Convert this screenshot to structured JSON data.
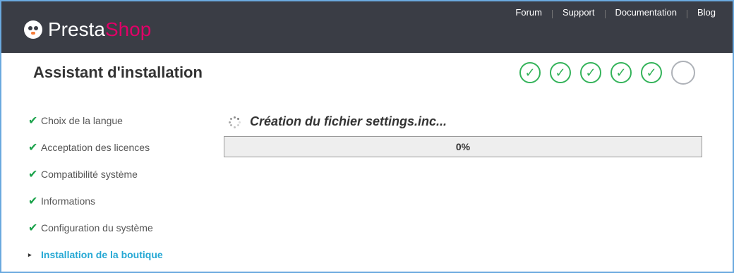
{
  "brand": {
    "part1": "Presta",
    "part2": "Shop"
  },
  "top_links": [
    "Forum",
    "Support",
    "Documentation",
    "Blog"
  ],
  "page_title": "Assistant d'installation",
  "step_indicators": {
    "completed": 5,
    "total": 6,
    "check_glyph": "✓"
  },
  "sidebar": {
    "check_glyph": "✔",
    "current_arrow": "▸",
    "items": [
      {
        "label": "Choix de la langue",
        "state": "done"
      },
      {
        "label": "Acceptation des licences",
        "state": "done"
      },
      {
        "label": "Compatibilité système",
        "state": "done"
      },
      {
        "label": "Informations",
        "state": "done"
      },
      {
        "label": "Configuration du système",
        "state": "done"
      },
      {
        "label": "Installation de la boutique",
        "state": "current"
      }
    ]
  },
  "status_text": "Création du fichier settings.inc...",
  "progress": {
    "value": 0,
    "label": "0%"
  },
  "colors": {
    "header_bg": "#3a3d45",
    "brand_accent": "#df0067",
    "check_green": "#34b35a",
    "current_item": "#26a8d4"
  }
}
